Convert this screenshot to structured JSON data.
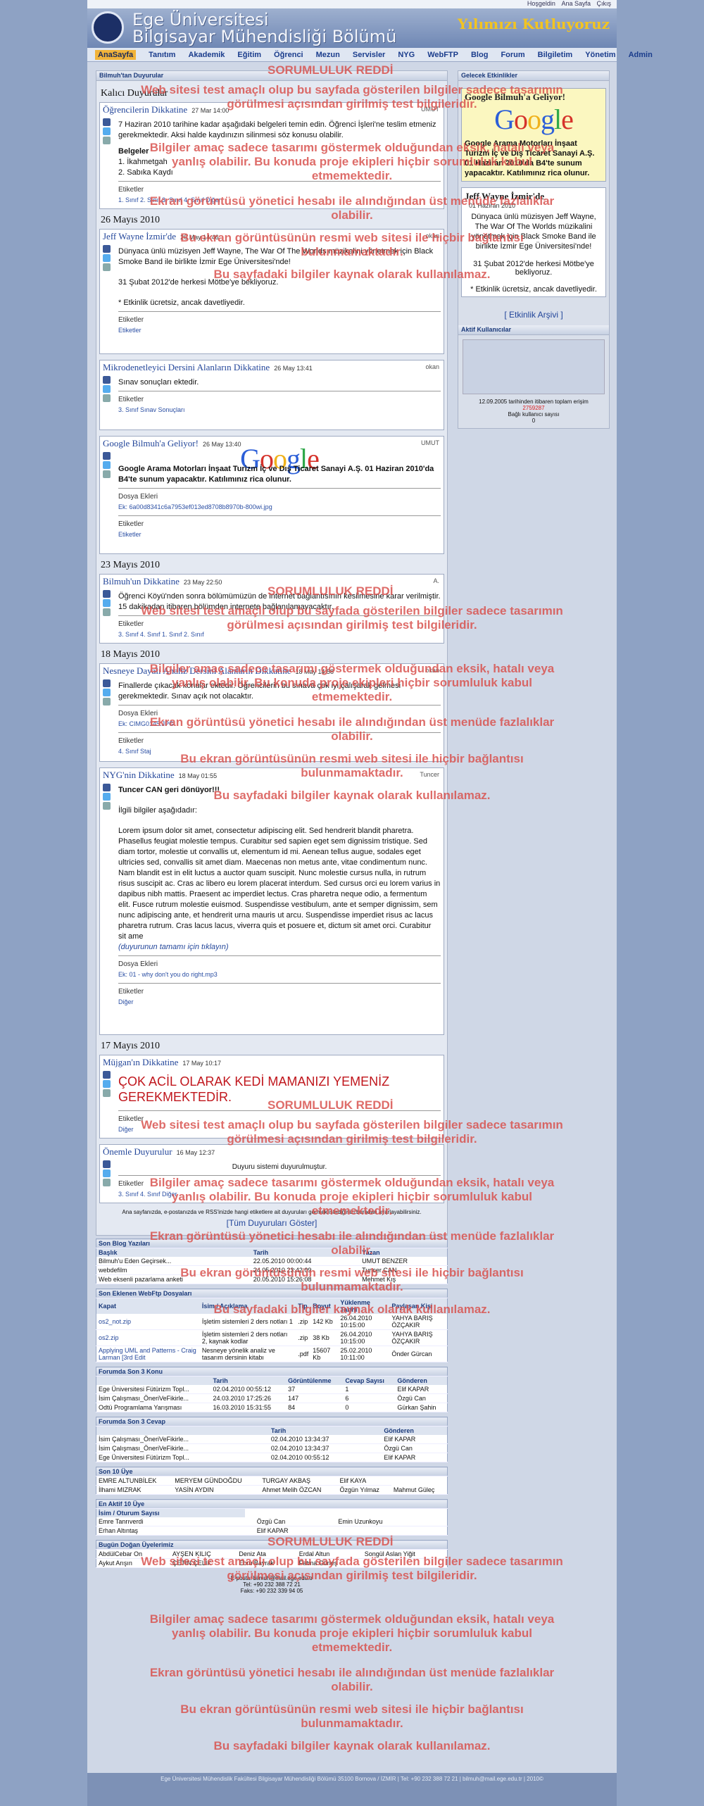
{
  "topbar": {
    "items": [
      "Hoşgeldin",
      "Ana Sayfa",
      "Çıkış"
    ]
  },
  "banner": {
    "title_line1": "Ege Üniversitesi",
    "title_line2": "Bilgisayar Mühendisliği Bölümü",
    "anniversary": "Yılımızı Kutluyoruz"
  },
  "nav": [
    "AnaSayfa",
    "Tanıtım",
    "Akademik",
    "Eğitim",
    "Öğrenci",
    "Mezun",
    "Servisler",
    "NYG",
    "WebFTP",
    "Blog",
    "Forum",
    "Bilgiletim",
    "Yönetim",
    "Admin"
  ],
  "left": {
    "header": "Bilmuh'tan Duyurular",
    "pinned_title": "Kalıcı Duyurular",
    "tags_label": "Etiketler",
    "news": [
      {
        "title": "Öğrencilerin Dikkatine",
        "date": "27 Mar 14:00",
        "author": "UMUT",
        "body": "7 Haziran 2010 tarihine kadar aşağıdaki belgeleri temin edin. Öğrenci İşleri'ne teslim etmeniz gerekmektedir. Aksi halde kaydınızın silinmesi söz konusu olabilir.",
        "list_title": "Belgeler",
        "list": [
          "1. İkahmetgah",
          "2. Sabıka Kaydı"
        ],
        "tags": "1. Sınıf  2. Sınıf  3. Sınıf  4. Sınıf  Diğer"
      }
    ],
    "dated": [
      {
        "day": "26 Mayıs 2010",
        "items": [
          {
            "title": "Jeff Wayne İzmir'de",
            "date": "26 May 14:46",
            "author": "okan",
            "body1": "Dünyaca ünlü müzisyen Jeff Wayne, The War Of The Worlds müzikalini yönetmek için Black Smoke Band ile birlikte İzmir Ege Üniversitesi'nde!",
            "body2": "31 Şubat 2012'de herkesi Mötbe'ye bekliyoruz.",
            "body3": "* Etkinlik ücretsiz, ancak davetliyedir.",
            "tags": "Etiketler"
          },
          {
            "title": "Mikrodenetleyici Dersini Alanların Dikkatine",
            "date": "26 May 13:41",
            "author": "okan",
            "body1": "Sınav sonuçları ektedir.",
            "tags": "3. Sınıf  Sınav Sonuçları"
          },
          {
            "title": "Google Bilmuh'a Geliyor!",
            "date": "26 May 13:40",
            "author": "UMUT",
            "body1": "Google Arama Motorları İnşaat Turizm İç ve Dış Ticaret Sanayi A.Ş. 01 Haziran 2010'da B4'te sunum yapacaktır. Katılımınız rica olunur.",
            "files": "Dosya Ekleri",
            "file": "Ek: 6a00d8341c6a7953ef013ed8708b8970b-800wi.jpg",
            "tags": "Etiketler"
          }
        ]
      },
      {
        "day": "23 Mayıs 2010",
        "items": [
          {
            "title": "Bilmuh'un Dikkatine",
            "date": "23 May 22:50",
            "author": "A.",
            "body1": "Öğrenci Köyü'nden sonra bölümümüzün de internet bağlantısının kesilmesine karar verilmiştir. 15 dakikadan itibaren bölümden internete bağlanılamayacaktır.",
            "tags": "3. Sınıf  4. Sınıf  1. Sınıf  2. Sınıf"
          }
        ]
      },
      {
        "day": "18 Mayıs 2010",
        "items": [
          {
            "title": "Nesneye Dayalı Analiz Dersini Alanların Dikkatine",
            "date": "18 May 14:58",
            "author": "okan",
            "body1": "Finallerde çıkacak konular ektedir. Öğrencilerin bu sınava çok iyi çalışarak gelmesi gerekmektedir. Sınav açık not olacaktır.",
            "files": "Dosya Ekleri",
            "file": "Ek: CIMG0145.JPG",
            "tags": "4. Sınıf  Staj"
          },
          {
            "title": "NYG'nin Dikkatine",
            "date": "18 May 01:55",
            "author": "Tuncer",
            "body1": "Tuncer CAN geri dönüyor!!!",
            "body2": "İlgili bilgiler aşağıdadır:",
            "body3": "Lorem ipsum dolor sit amet, consectetur adipiscing elit. Sed hendrerit blandit pharetra. Phasellus feugiat molestie tempus. Curabitur sed sapien eget sem dignissim tristique. Sed diam tortor, molestie ut convallis ut, elementum id mi. Aenean tellus augue, sodales eget ultricies sed, convallis sit amet diam. Maecenas non metus ante, vitae condimentum nunc. Nam blandit est in elit luctus a auctor quam suscipit. Nunc molestie cursus nulla, in rutrum risus suscipit ac. Cras ac libero eu lorem placerat interdum. Sed cursus orci eu lorem varius in dapibus nibh mattis. Praesent ac imperdiet lectus. Cras pharetra neque odio, a fermentum elit. Fusce rutrum molestie euismod. Suspendisse vestibulum, ante et semper dignissim, sem nunc adipiscing ante, et hendrerit urna mauris ut arcu. Suspendisse imperdiet risus ac lacus pharetra rutrum. Cras lacus lacus, viverra quis et posuere et, dictum sit amet orci. Curabitur sit ame",
            "more": "(duyurunun tamamı için tıklayın)",
            "files": "Dosya Ekleri",
            "file": "Ek: 01 - why don't you do right.mp3",
            "tags": "Diğer"
          }
        ]
      },
      {
        "day": "17 Mayıs 2010",
        "items": [
          {
            "title": "Müjgan'ın Dikkatine",
            "date": "17 May 10:17",
            "author": "",
            "body_red": "ÇOK ACİL OLARAK KEDİ MAMANIZI YEMENİZ GEREKMEKTEDİR.",
            "tags": "Diğer"
          },
          {
            "title": "Önemle Duyurulur",
            "date": "16 May 12:37",
            "author": "",
            "body1": "Duyuru sistemi duyurulmuştur.",
            "tags": "3. Sınıf  4. Sınıf  Diğer"
          }
        ]
      }
    ],
    "rss_note": "Ana sayfanızda, e-postanızda ve RSS'inizde hangi etiketlere ait duyuruları görmek istediğinizi buradan ayarlayabilirsiniz.",
    "all_link": "[Tüm Duyuruları Göster]"
  },
  "right": {
    "header": "Gelecek Etkinlikler",
    "events": [
      {
        "title": "Google Bilmuh'a Geliyor!",
        "date": "",
        "body": "Google Arama Motorları İnşaat Turizm İç ve Dış Ticaret Sanayi A.Ş. 01 Haziran 2010'da B4'te sunum yapacaktır. Katılımınız rica olunur."
      },
      {
        "title": "Jeff Wayne İzmir'de",
        "date": "01 Haziran 2010",
        "body": "Dünyaca ünlü müzisyen Jeff Wayne, The War Of The Worlds müzikalini yönetmek için Black Smoke Band ile birlikte İzmir Ege Üniversitesi'nde!",
        "body2": "31 Şubat 2012'de herkesi Mötbe'ye bekliyoruz.",
        "body3": "* Etkinlik ücretsiz, ancak davetliyedir."
      }
    ],
    "archive": "[ Etkinlik Arşivi ]",
    "active_users": "Aktif Kullanıcılar",
    "counter_text": "12.09.2005 tarihinden itibaren toplam erişim",
    "counter": "2759287",
    "connected": "Bağlı kullanıcı sayısı",
    "connected_n": "0"
  },
  "tables": {
    "blog": {
      "title": "Son Blog Yazıları",
      "cols": [
        "Başlık",
        "Tarih",
        "Yazan"
      ],
      "rows": [
        [
          "Bilmuh'u Eden Geçirsek...",
          "22.05.2010 00:00:44",
          "UMUT BENZER"
        ],
        [
          "webdefilm",
          "24.05.2010 23:42:09",
          "Tuncer CAN"
        ],
        [
          "Web eksenli pazarlama anketi",
          "20.05.2010 15:26:08",
          "Mehmet Kış"
        ]
      ]
    },
    "webftp": {
      "title": "Son Eklenen WebFtp Dosyaları",
      "cols": [
        "Kapat",
        "İsim / Açıklama",
        "Tip",
        "Boyut",
        "Yüklenme Tarihi",
        "Paylaşan Kişi"
      ],
      "rows": [
        [
          "os2_not.zip",
          "İşletim sistemleri 2 ders notları 1",
          ".zip",
          "142 Kb",
          "26.04.2010 10:15:00",
          "YAHYA BARIŞ ÖZÇAKIR"
        ],
        [
          "os2.zip",
          "İşletim sistemleri 2 ders notları 2, kaynak kodlar",
          ".zip",
          "38 Kb",
          "26.04.2010 10:15:00",
          "YAHYA BARIŞ ÖZÇAKIR"
        ],
        [
          "Applying UML and Patterns - Craig Larman [3rd Edit",
          "Nesneye yönelik analiz ve tasarım dersinin kitabı",
          ".pdf",
          "15607 Kb",
          "25.02.2010 10:11:00",
          "Önder Gürcan"
        ]
      ]
    },
    "forum_konu": {
      "title": "Forumda Son 3 Konu",
      "cols": [
        "",
        "Tarih",
        "Görüntülenme",
        "Cevap Sayısı",
        "Gönderen"
      ],
      "rows": [
        [
          "Ege Üniversitesi Fütürizm Topl...",
          "02.04.2010 00:55:12",
          "37",
          "1",
          "Elif KAPAR"
        ],
        [
          "İsim Çalışması_ÖneriVeFikirle...",
          "24.03.2010 17:25:26",
          "147",
          "6",
          "Özgü Can"
        ],
        [
          "Odtü Programlama Yarışması",
          "16.03.2010 15:31:55",
          "84",
          "0",
          "Gürkan Şahin"
        ]
      ]
    },
    "forum_cevap": {
      "title": "Forumda Son 3 Cevap",
      "cols": [
        "",
        "Tarih",
        "Gönderen"
      ],
      "rows": [
        [
          "İsim Çalışması_ÖneriVeFikirle...",
          "02.04.2010 13:34:37",
          "Elif KAPAR"
        ],
        [
          "İsim Çalışması_ÖneriVeFikirle...",
          "02.04.2010 13:34:37",
          "Özgü Can"
        ],
        [
          "Ege Üniversitesi Fütürizm Topl...",
          "02.04.2010 00:55:12",
          "Elif KAPAR"
        ]
      ]
    },
    "son10": {
      "title": "Son 10 Üye",
      "rows": [
        [
          "EMRE ALTUNBİLEK",
          "MERYEM GÜNDOĞDU",
          "TURGAY AKBAŞ",
          "Elif KAYA"
        ],
        [
          "İlhami MIZRAK",
          "YASİN AYDIN",
          "Ahmet Melih ÖZCAN",
          "Özgün Yılmaz",
          "Mahmut Güleç"
        ]
      ]
    },
    "aktif10": {
      "title": "En Aktif 10 Üye",
      "cols": [
        "İsim / Oturum Sayısı"
      ],
      "rows": [
        [
          "Emre Tanrıverdi",
          "",
          "Özgü Can",
          "Emin Uzunkoyu"
        ],
        [
          "Erhan Altıntaş",
          "",
          "Elif KAPAR",
          ""
        ]
      ]
    },
    "bday": {
      "title": "Bugün Doğan Üyelerimiz",
      "rows": [
        [
          "AbdülCebar On",
          "AYŞEN KILIÇ",
          "Deniz Ata",
          "Erdal Altun",
          "Songül Aslan Yiğit"
        ],
        [
          "Aykut Arışın",
          "ÇETİN ÇELİK",
          "Ebru Bayrak",
          "Fatma Güneş",
          ""
        ]
      ]
    }
  },
  "contact": {
    "email": "E-posta: bilmuh@mail.ege.edu.tr",
    "tel": "Tel: +90 232 388 72 21",
    "fax": "Faks: +90 232 339 94 05"
  },
  "footer": "Ege Üniversitesi Mühendislik Fakültesi Bilgisayar Mühendisliği Bölümü 35100 Bornova / İZMİR | Tel: +90 232 388 72 21 | bilmuh@mail.ege.edu.tr | 2010©",
  "watermark": {
    "title": "SORUMLULUK REDDİ",
    "lines": [
      "Web sitesi test amaçlı olup bu sayfada gösterilen bilgiler sadece tasarımın görülmesi açısından girilmiş test bilgileridir.",
      "Bilgiler amaç sadece tasarımı göstermek olduğundan eksik, hatalı veya yanlış olabilir. Bu konuda proje ekipleri hiçbir sorumluluk kabul etmemektedir.",
      "Ekran görüntüsü yönetici hesabı ile alındığından üst menüde fazlalıklar olabilir.",
      "Bu ekran görüntüsünün resmi web sitesi ile hiçbir bağlantısı bulunmamaktadır.",
      "Bu sayfadaki bilgiler kaynak olarak kullanılamaz."
    ]
  },
  "colors": {
    "nav_active": "#f1b33a",
    "link": "#23469a",
    "watermark": "#d9534f"
  }
}
